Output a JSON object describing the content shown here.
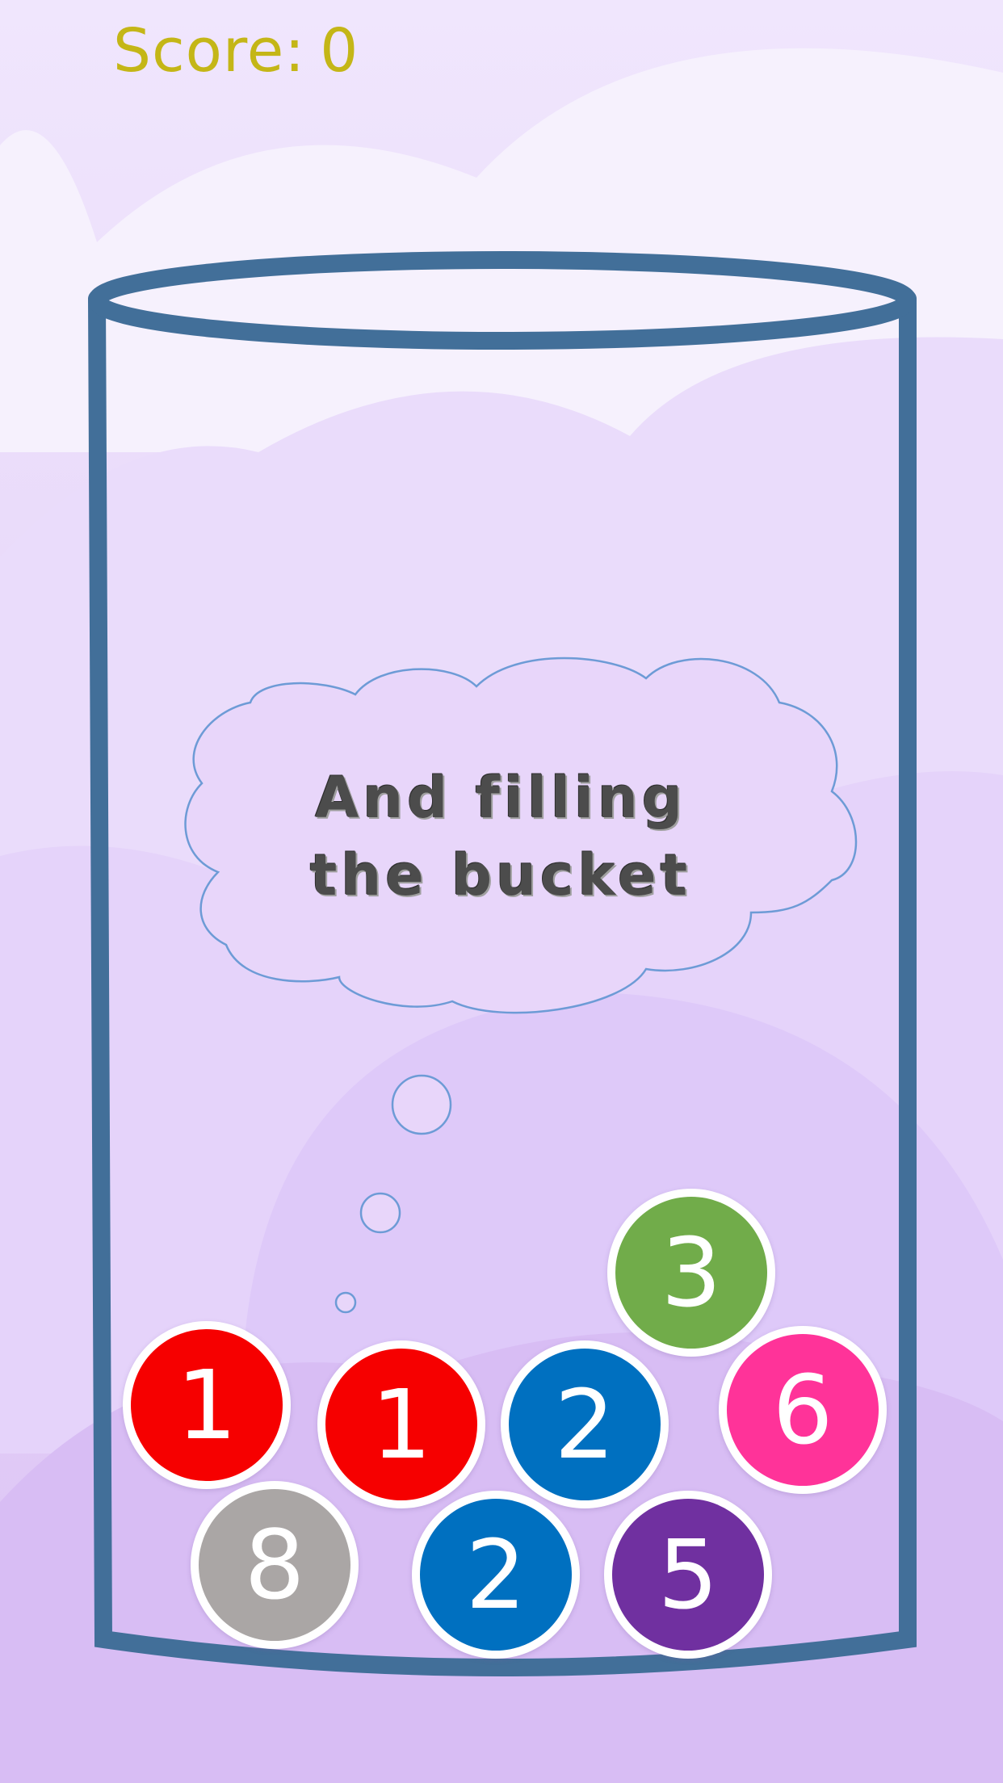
{
  "score": {
    "label": "Score:",
    "value": "0",
    "color": "#c4b617"
  },
  "thought": {
    "line1": "And filling",
    "line2": "the bucket"
  },
  "colors": {
    "background": "#eadcfa",
    "bucket_outline": "#426f99",
    "cloud_outline": "#6d9bd6"
  },
  "balls": [
    {
      "number": "3",
      "color": "#71ac4a"
    },
    {
      "number": "1",
      "color": "#f60000"
    },
    {
      "number": "1",
      "color": "#f60000"
    },
    {
      "number": "2",
      "color": "#0070c0"
    },
    {
      "number": "6",
      "color": "#ff3399"
    },
    {
      "number": "8",
      "color": "#aaa6a5"
    },
    {
      "number": "2",
      "color": "#0070c0"
    },
    {
      "number": "5",
      "color": "#7030a0"
    }
  ]
}
